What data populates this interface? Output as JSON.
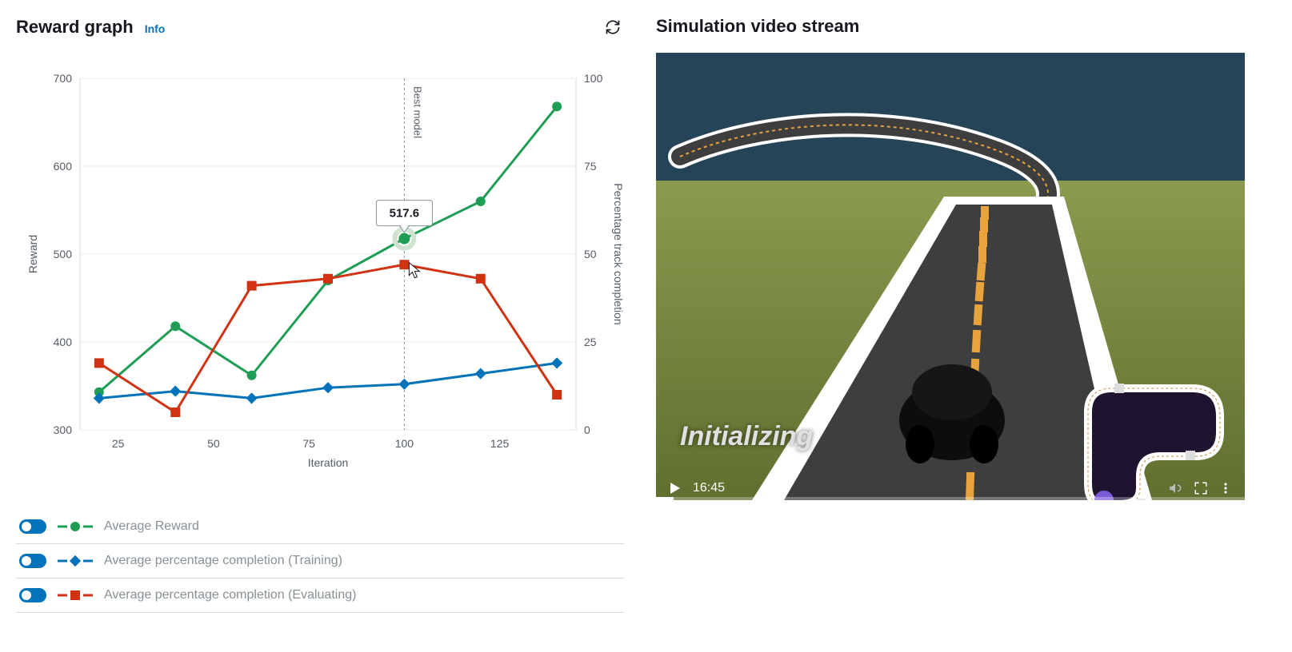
{
  "left_panel": {
    "title": "Reward graph",
    "info_label": "Info"
  },
  "right_panel": {
    "title": "Simulation video stream",
    "status_text": "Initializing",
    "time_label": "16:45"
  },
  "legend": {
    "items": [
      {
        "label": "Average Reward",
        "color": "#1f9d55",
        "marker": "circle"
      },
      {
        "label": "Average percentage completion (Training)",
        "color": "#0073bb",
        "marker": "diamond"
      },
      {
        "label": "Average percentage completion (Evaluating)",
        "color": "#d13212",
        "marker": "square"
      }
    ]
  },
  "chart_data": {
    "type": "line",
    "xlabel": "Iteration",
    "ylabel_left": "Reward",
    "ylabel_right": "Percentage track completion",
    "x": [
      20,
      40,
      60,
      80,
      100,
      120,
      140
    ],
    "ylim_left": [
      300,
      700
    ],
    "ylim_right": [
      0,
      100
    ],
    "xlim": [
      15,
      145
    ],
    "best_model_iteration": 100,
    "tooltip_value": "517.6",
    "series": [
      {
        "name": "Average Reward",
        "axis": "left",
        "color": "#1f9d55",
        "marker": "circle",
        "values": [
          343,
          418,
          362,
          470,
          517.6,
          560,
          668
        ]
      },
      {
        "name": "Average percentage completion (Training)",
        "axis": "right",
        "color": "#0073bb",
        "marker": "diamond",
        "values": [
          9,
          11,
          9,
          12,
          13,
          16,
          19
        ]
      },
      {
        "name": "Average percentage completion (Evaluating)",
        "axis": "right",
        "color": "#d13212",
        "marker": "square",
        "values": [
          19,
          5,
          41,
          43,
          47,
          43,
          10
        ]
      }
    ],
    "ticks_left": [
      300,
      400,
      500,
      600,
      700
    ],
    "ticks_right": [
      0,
      25,
      50,
      75,
      100
    ],
    "ticks_x": [
      25,
      50,
      75,
      100,
      125
    ]
  }
}
